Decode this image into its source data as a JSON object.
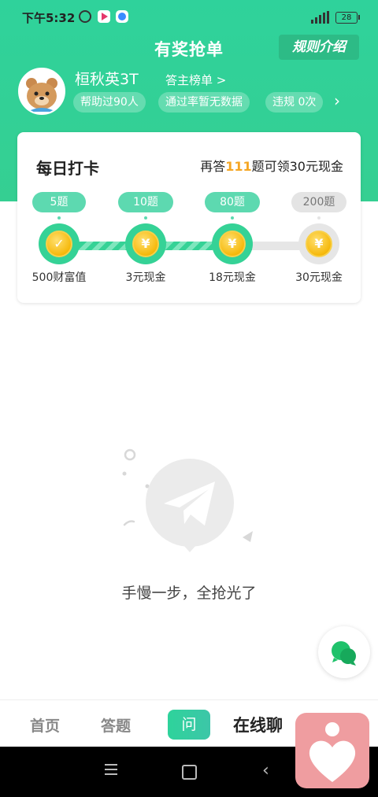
{
  "status_bar": {
    "time": "下午5:32",
    "battery": "28"
  },
  "header": {
    "title": "有奖抢单",
    "rules_button": "规则介绍"
  },
  "user": {
    "name": "桓秋英3T",
    "rank_link": "答主榜单 >",
    "stats": [
      "帮助过90人",
      "通过率暂无数据",
      "违规 0次"
    ]
  },
  "checkin": {
    "title": "每日打卡",
    "hint_prefix": "再答",
    "hint_count": "111",
    "hint_suffix": "题可领30元现金",
    "milestones": [
      {
        "badge": "5题",
        "reward": "500财富值",
        "state": "done"
      },
      {
        "badge": "10题",
        "reward": "3元现金",
        "state": "active"
      },
      {
        "badge": "80题",
        "reward": "18元现金",
        "state": "active"
      },
      {
        "badge": "200题",
        "reward": "30元现金",
        "state": "locked"
      }
    ]
  },
  "empty": {
    "message": "手慢一步，全抢光了"
  },
  "bottom_nav": {
    "home": "首页",
    "answer": "答题",
    "ask": "问",
    "online": "在线聊"
  },
  "colors": {
    "brand": "#33d196",
    "accent": "#f5a623"
  }
}
